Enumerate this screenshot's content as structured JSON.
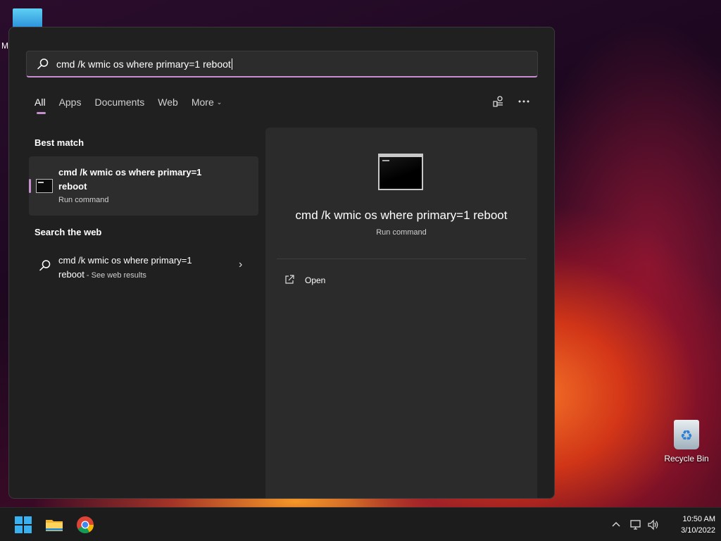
{
  "desktop": {
    "partial_label": "M",
    "recycle_bin_label": "Recycle Bin"
  },
  "search": {
    "query": "cmd /k wmic os where primary=1 reboot"
  },
  "tabs": [
    {
      "label": "All",
      "active": true
    },
    {
      "label": "Apps"
    },
    {
      "label": "Documents"
    },
    {
      "label": "Web"
    },
    {
      "label": "More",
      "dropdown": true
    }
  ],
  "best_match": {
    "section_title": "Best match",
    "title_line1": "cmd /k wmic os where primary=1",
    "title_line2": "reboot",
    "subtitle": "Run command"
  },
  "web": {
    "section_title": "Search the web",
    "line1": "cmd /k wmic os where primary=1",
    "line2": "reboot",
    "suffix": " - See web results"
  },
  "detail": {
    "title": "cmd /k wmic os where primary=1 reboot",
    "subtitle": "Run command",
    "actions": [
      {
        "label": "Open",
        "icon": "open-external-icon"
      }
    ]
  },
  "taskbar": {
    "apps": [
      "windows-start-icon",
      "file-explorer-icon",
      "chrome-icon"
    ],
    "tray": [
      "chevron-up-icon",
      "network-icon",
      "volume-icon"
    ],
    "time": "10:50 AM",
    "date": "3/10/2022"
  },
  "colors": {
    "accent": "#c78fd0",
    "panel": "#202020",
    "detail_panel": "#2b2b2b"
  }
}
